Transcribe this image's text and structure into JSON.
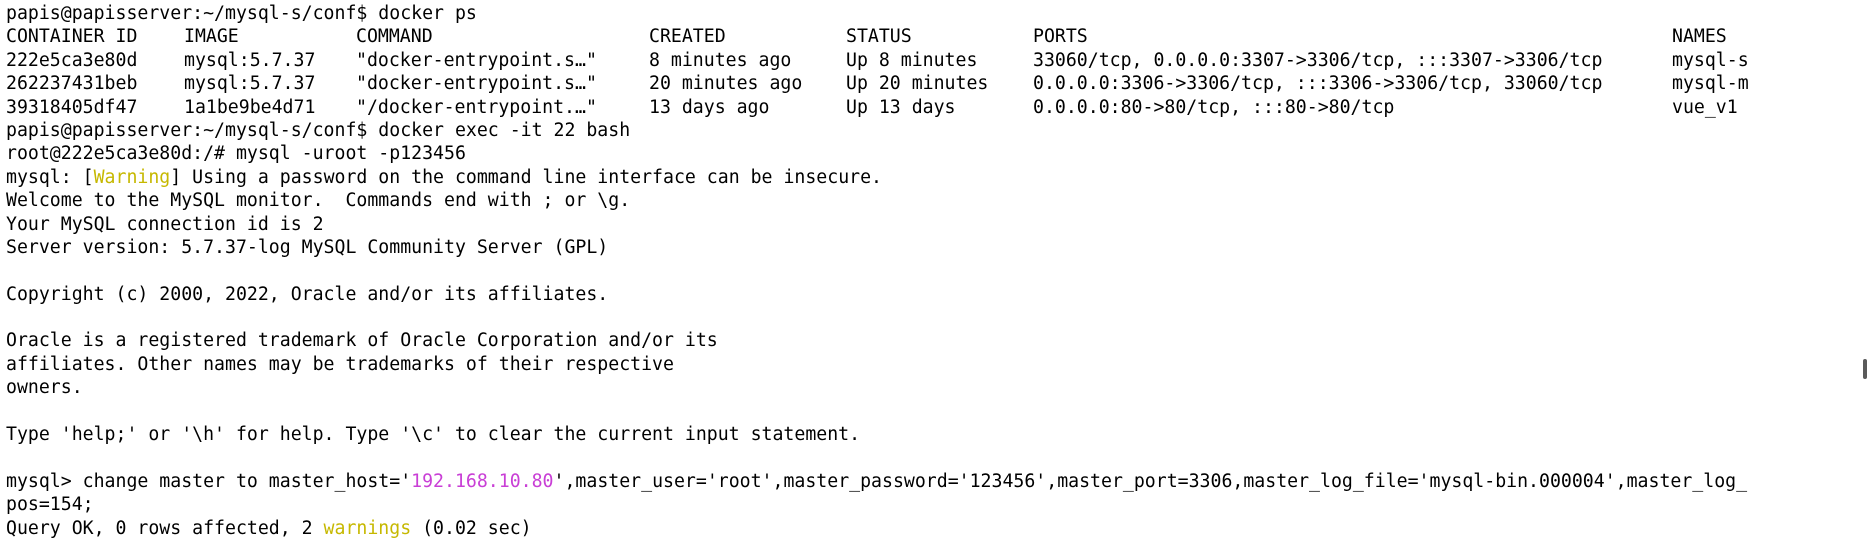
{
  "colors": {
    "background": "#ffffff",
    "text": "#000000",
    "warning": "#c6b800",
    "ip": "#c93fd6"
  },
  "prompt1": "papis@papisserver:~/mysql-s/conf$ docker ps",
  "table": {
    "headers": [
      "CONTAINER ID",
      "IMAGE",
      "COMMAND",
      "CREATED",
      "STATUS",
      "PORTS",
      "NAMES"
    ],
    "rows": [
      [
        "222e5ca3e80d",
        "mysql:5.7.37",
        "\"docker-entrypoint.s…\"",
        "8 minutes ago",
        "Up 8 minutes",
        "33060/tcp, 0.0.0.0:3307->3306/tcp, :::3307->3306/tcp",
        "mysql-s"
      ],
      [
        "262237431beb",
        "mysql:5.7.37",
        "\"docker-entrypoint.s…\"",
        "20 minutes ago",
        "Up 20 minutes",
        "0.0.0.0:3306->3306/tcp, :::3306->3306/tcp, 33060/tcp",
        "mysql-m"
      ],
      [
        "39318405df47",
        "1a1be9be4d71",
        "\"/docker-entrypoint.…\"",
        "13 days ago",
        "Up 13 days",
        "0.0.0.0:80->80/tcp, :::80->80/tcp",
        "vue_v1"
      ]
    ]
  },
  "prompt2": "papis@papisserver:~/mysql-s/conf$ docker exec -it 22 bash",
  "prompt3": "root@222e5ca3e80d:/# mysql -uroot -p123456",
  "warning_line": {
    "prefix": "mysql: [",
    "tag": "Warning",
    "suffix": "] Using a password on the command line interface can be insecure."
  },
  "welcome": [
    "Welcome to the MySQL monitor.  Commands end with ; or \\g.",
    "Your MySQL connection id is 2",
    "Server version: 5.7.37-log MySQL Community Server (GPL)"
  ],
  "copyright": "Copyright (c) 2000, 2022, Oracle and/or its affiliates.",
  "trademark": [
    "Oracle is a registered trademark of Oracle Corporation and/or its",
    "affiliates. Other names may be trademarks of their respective",
    "owners."
  ],
  "help": "Type 'help;' or '\\h' for help. Type '\\c' to clear the current input statement.",
  "command": {
    "prefix": "mysql> change master to master_host='",
    "ip": "192.168.10.80",
    "suffix": "',master_user='root',master_password='123456',master_port=3306,master_log_file='mysql-bin.000004',master_log_",
    "cont": "pos=154;"
  },
  "result": {
    "prefix": "Query OK, 0 rows affected, 2 ",
    "warn": "warnings",
    "suffix": " (0.02 sec)"
  }
}
